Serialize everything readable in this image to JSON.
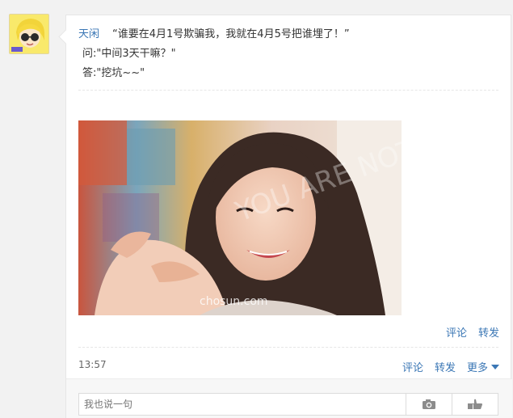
{
  "post": {
    "author": "天闲",
    "line1": "“谁要在4月1号欺骗我，我就在4月5号把谁埋了！”",
    "line2": "问:\"中间3天干嘛？\"",
    "line3": "答:\"挖坑~~\""
  },
  "image_actions": {
    "comment": "评论",
    "forward": "转发"
  },
  "meta": {
    "time": "13:57",
    "comment": "评论",
    "forward": "转发",
    "more": "更多"
  },
  "photo": {
    "watermark": "chosun.com",
    "watermark_large": "YOU ARE NOT ALONE"
  },
  "reply": {
    "placeholder": "我也说一句"
  },
  "icons": [
    "avatar",
    "camera-icon",
    "like-hand-icon",
    "chevron-down-icon"
  ],
  "colors": {
    "link": "#3b77b5",
    "background": "#f2f2f2",
    "card": "#ffffff"
  }
}
